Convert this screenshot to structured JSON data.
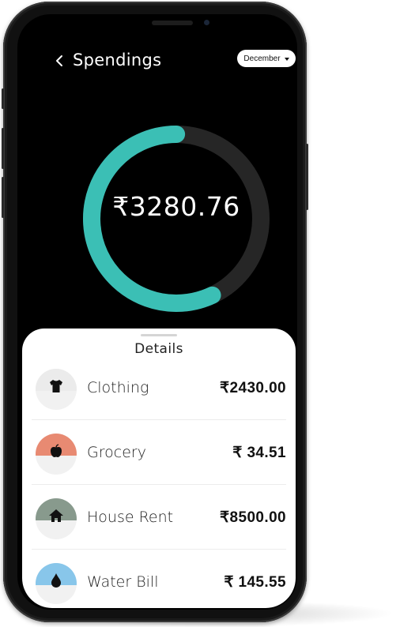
{
  "header": {
    "title": "Spendings",
    "month_selected": "December",
    "back_icon": "chevron-left-icon",
    "dropdown_icon": "caret-down-icon"
  },
  "summary": {
    "total": "₹3280.76",
    "accent_color": "#3bbfb5",
    "track_color": "#262626",
    "progress_fraction": 0.57
  },
  "details": {
    "title": "Details",
    "items": [
      {
        "name": "Clothing",
        "amount": "₹2430.00",
        "icon": "tshirt-icon",
        "color": "#ebebeb"
      },
      {
        "name": "Grocery",
        "amount": "₹ 34.51",
        "icon": "apple-icon",
        "color": "#e88a72"
      },
      {
        "name": "House Rent",
        "amount": "₹8500.00",
        "icon": "house-icon",
        "color": "#889a8d"
      },
      {
        "name": "Water Bill",
        "amount": "₹ 145.55",
        "icon": "water-drop-icon",
        "color": "#88c6ea"
      }
    ]
  }
}
